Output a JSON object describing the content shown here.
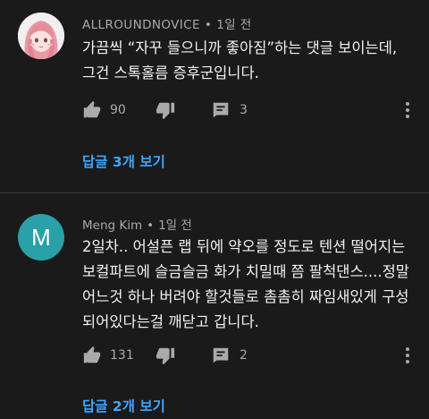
{
  "comments": [
    {
      "author": "ALLROUNDNOVICE",
      "time": "1일 전",
      "avatar_icon": "anime-girl-avatar",
      "text": "가끔씩 “자꾸 들으니까 좋아짐”하는 댓글 보이는데, 그건 스톡홀름 증후군입니다.",
      "likes": "90",
      "replies": "3",
      "replies_link": "답글 3개 보기"
    },
    {
      "author": "Meng Kim",
      "time": "1일 전",
      "avatar_letter": "M",
      "text": "2일차.. 어설픈 랩 뒤에 약오를 정도로 텐션 떨어지는 보컬파트에 슬금슬금 화가 치밀때 쯤 팔척댄스....정말 어느것 하나 버려야 할것들로 촘촘히 짜임새있게 구성되어있다는걸 깨닫고 갑니다.",
      "likes": "131",
      "replies": "2",
      "replies_link": "답글 2개 보기"
    }
  ],
  "colors": {
    "background": "#1a1a1a",
    "link": "#3ea6ff",
    "secondary_text": "#aaaaaa",
    "avatar_teal": "#2aa0a8"
  },
  "icons": [
    "thumbs-up-icon",
    "thumbs-down-icon",
    "reply-icon",
    "more-vert-icon"
  ]
}
